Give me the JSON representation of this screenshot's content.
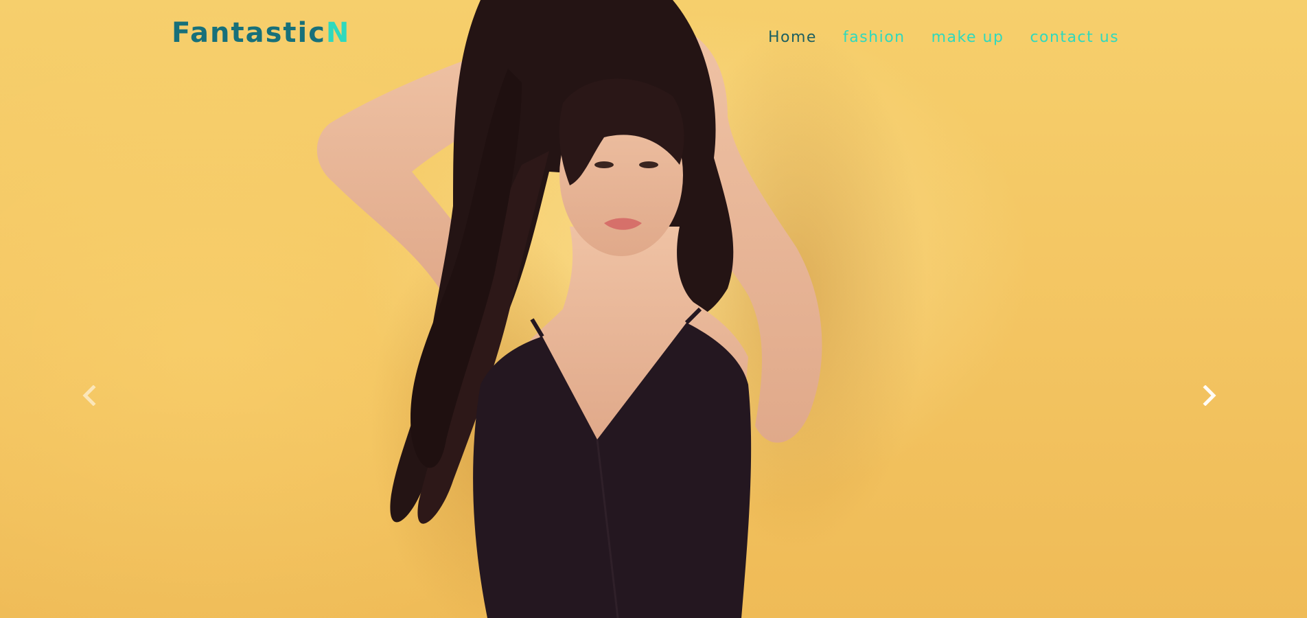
{
  "brand": {
    "text_main": "Fantastic",
    "text_accent": "N",
    "color_main": "#17707a",
    "color_accent": "#2fd9bd"
  },
  "nav": {
    "items": [
      {
        "label": "Home",
        "active": true
      },
      {
        "label": "fashion",
        "active": false
      },
      {
        "label": "make up",
        "active": false
      },
      {
        "label": "contact us",
        "active": false
      }
    ]
  },
  "carousel": {
    "prev_icon": "chevron-left-icon",
    "next_icon": "chevron-right-icon",
    "background_color": "#f3c75e"
  }
}
